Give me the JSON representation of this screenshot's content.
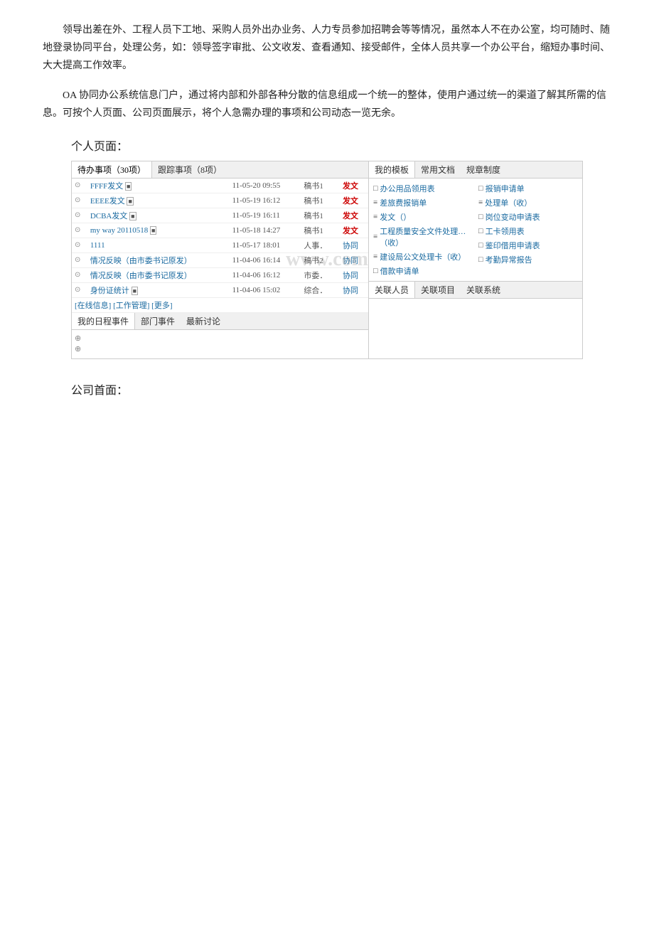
{
  "paragraphs": {
    "p1": "领导出差在外、工程人员下工地、采购人员外出办业务、人力专员参加招聘会等等情况，虽然本人不在办公室，均可随时、随地登录协同平台，处理公务，如：领导签字审批、公文收发、查看通知、接受邮件，全体人员共享一个办公平台，缩短办事时间、大大提高工作效率。",
    "p2": "OA 协同办公系统信息门户，通过将内部和外部各种分散的信息组成一个统一的整体，使用户通过统一的渠道了解其所需的信息。可按个人页面、公司页面展示，将个人急需办理的事项和公司动态一览无余。"
  },
  "personal_page_label": "个人页面：",
  "company_page_label": "公司首面：",
  "left_tabs": {
    "active": "待办事项（30项）",
    "inactive": "跟踪事项（8项）"
  },
  "tasks": [
    {
      "icon": "⊙",
      "title": "FFFF发文",
      "has_icon": true,
      "date": "11-05-20 09:55",
      "dept": "稿书1",
      "status": "发文",
      "status_type": "fa"
    },
    {
      "icon": "⊙",
      "title": "EEEE发文",
      "has_icon": true,
      "date": "11-05-19 16:12",
      "dept": "稿书1",
      "status": "发文",
      "status_type": "fa"
    },
    {
      "icon": "⊙",
      "title": "DCBA发文",
      "has_icon": true,
      "date": "11-05-19 16:11",
      "dept": "稿书1",
      "status": "发文",
      "status_type": "fa"
    },
    {
      "icon": "⊙",
      "title": "my way 20110518",
      "has_icon": true,
      "date": "11-05-18 14:27",
      "dept": "稿书1",
      "status": "发文",
      "status_type": "fa"
    },
    {
      "icon": "⊙",
      "title": "1111",
      "has_icon": false,
      "date": "11-05-17 18:01",
      "dept": "人事．",
      "status": "协同",
      "status_type": "xietong"
    },
    {
      "icon": "⊙",
      "title": "情况反映（由市委书记原发）",
      "has_icon": false,
      "date": "11-04-06 16:14",
      "dept": "稿书2",
      "status": "协同",
      "status_type": "xietong"
    },
    {
      "icon": "⊙",
      "title": "情况反映（由市委书记原发）",
      "has_icon": false,
      "date": "11-04-06 16:12",
      "dept": "市委．",
      "status": "协同",
      "status_type": "xietong"
    },
    {
      "icon": "⊙",
      "title": "身份证统计",
      "has_icon": true,
      "date": "11-04-06 15:02",
      "dept": "综合．",
      "status": "协同",
      "status_type": "xietong"
    }
  ],
  "footer_links": "[在线信息] [工作管理] [更多]",
  "schedule_tabs": {
    "active": "我的日程事件",
    "tab2": "部门事件",
    "tab3": "最新讨论"
  },
  "schedule_items": [
    "⊕",
    "⊕"
  ],
  "right_tabs": {
    "active": "我的模板",
    "tab2": "常用文档",
    "tab3": "规章制度"
  },
  "templates_left": [
    {
      "icon": "□",
      "text": "办公用品领用表"
    },
    {
      "icon": "≡",
      "text": "差旅费报销单"
    },
    {
      "icon": "≡",
      "text": "发文（）"
    },
    {
      "icon": "≡",
      "text": "工程质量安全文件处理…（收）"
    },
    {
      "icon": "≡",
      "text": "建设局公文处理卡（收）"
    },
    {
      "icon": "□",
      "text": "借款申请单"
    }
  ],
  "templates_right": [
    {
      "icon": "□",
      "text": "报销申请单"
    },
    {
      "icon": "≡",
      "text": "处理单（收）"
    },
    {
      "icon": "□",
      "text": "岗位变动申请表"
    },
    {
      "icon": "□",
      "text": "工卡领用表"
    },
    {
      "icon": "□",
      "text": "鉴印借用申请表"
    },
    {
      "icon": "□",
      "text": "考勤异常报告"
    }
  ],
  "right_bottom_tabs": {
    "active": "关联人员",
    "tab2": "关联项目",
    "tab3": "关联系统"
  },
  "watermark": "www.com"
}
